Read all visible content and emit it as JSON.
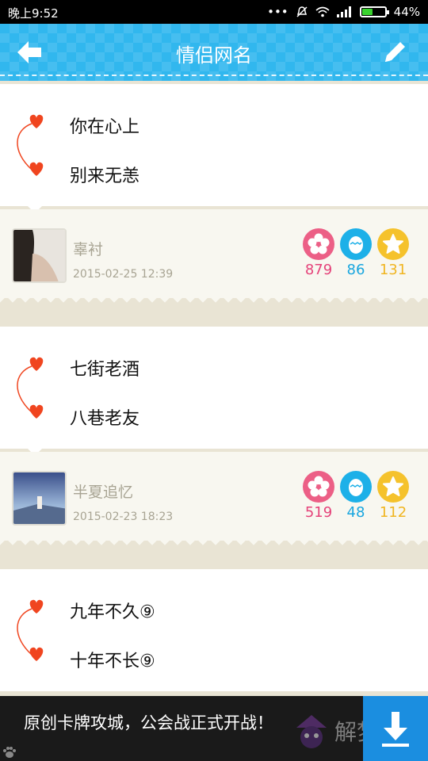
{
  "status_bar": {
    "time": "晚上9:52",
    "battery": "44%",
    "battery_level": 0.44
  },
  "title_bar": {
    "title": "情侣网名",
    "back_icon": "arrow-left-icon",
    "edit_icon": "pencil-icon"
  },
  "posts": [
    {
      "line1": "你在心上",
      "line2": "别来无恙",
      "user": "辜衬",
      "date": "2015-02-25 12:39",
      "flower": "879",
      "egg": "86",
      "star": "131"
    },
    {
      "line1": "七街老酒",
      "line2": "八巷老友",
      "user": "半夏追忆",
      "date": "2015-02-23 18:23",
      "flower": "519",
      "egg": "48",
      "star": "112"
    },
    {
      "line1": "九年不久⑨",
      "line2": "十年不长⑨"
    }
  ],
  "ad": {
    "text": "原创卡牌攻城，公会战正式开战！",
    "download_icon": "download-icon",
    "watermark": "解梦佬"
  },
  "colors": {
    "accent": "#31b7ee",
    "heart": "#f0451f",
    "flower": "#ec5f86",
    "egg": "#1db0e8",
    "star": "#f5c22c"
  }
}
